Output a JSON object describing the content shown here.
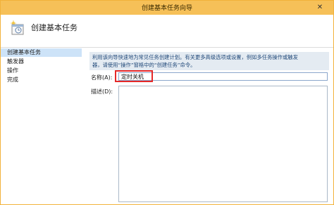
{
  "window": {
    "title": "创建基本任务向导",
    "close_glyph": "✕"
  },
  "header": {
    "title": "创建基本任务",
    "icon": "scheduled-task-wizard-icon"
  },
  "sidebar": {
    "steps": [
      {
        "label": "创建基本任务",
        "active": true
      },
      {
        "label": "触发器",
        "active": false
      },
      {
        "label": "操作",
        "active": false
      },
      {
        "label": "完成",
        "active": false
      }
    ]
  },
  "content": {
    "help_line1": "利用该向导快速地为常见任务创建计划。有关更多高级选项或设置，例如多任务操作或触发",
    "help_line2": "器，请使用“操作”窗格中的“创建任务”命令。",
    "name_label": "名称(A):",
    "name_value": "定时关机",
    "desc_label": "描述(D):",
    "desc_value": ""
  },
  "colors": {
    "titlebar": "#f6c058",
    "active_step": "#cde3f8",
    "highlight": "#e52828"
  }
}
